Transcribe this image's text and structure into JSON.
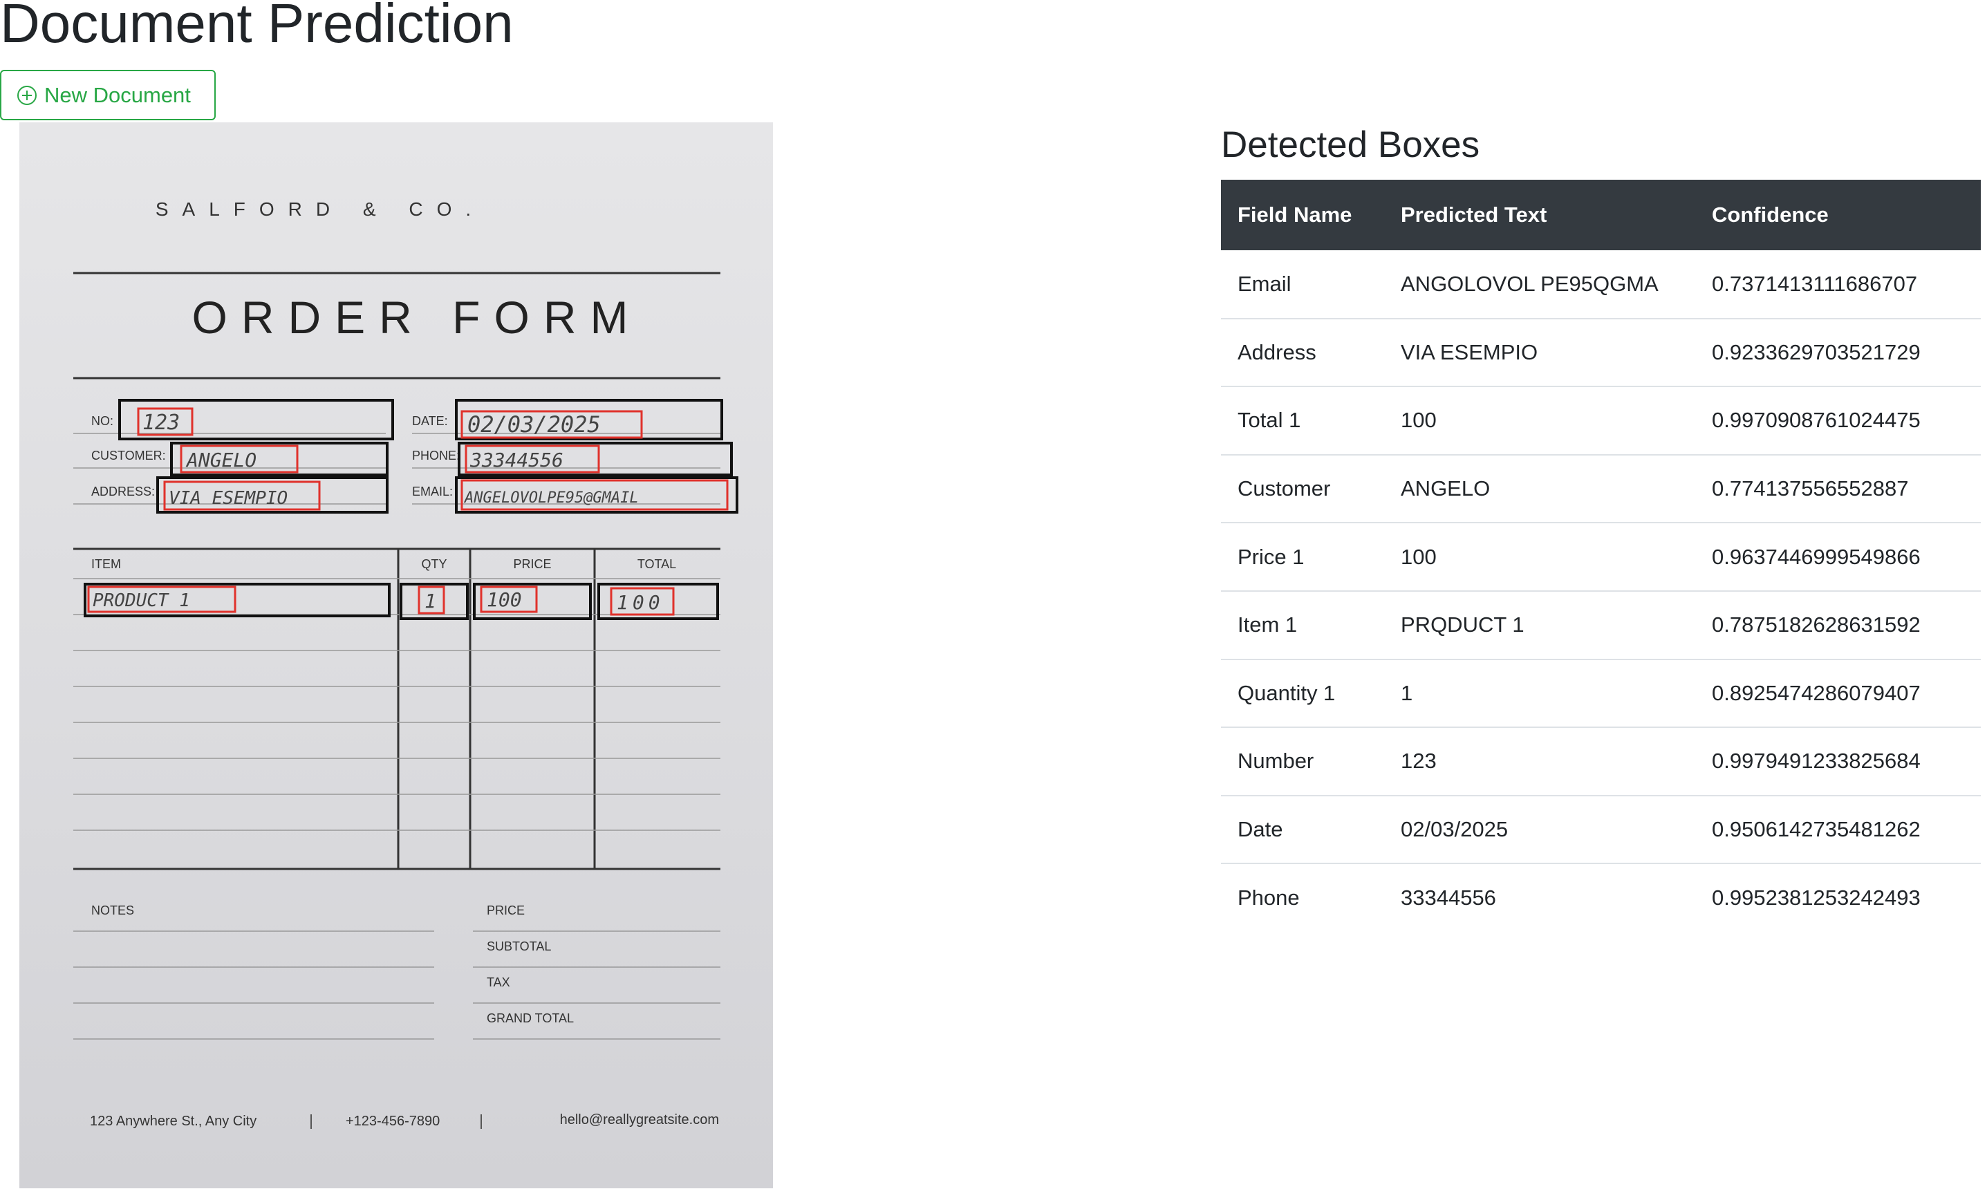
{
  "page": {
    "title": "Document Prediction",
    "new_button_label": "New Document",
    "new_button_icon": "plus-circle-icon"
  },
  "document": {
    "company": "SALFORD & CO.",
    "form_title": "ORDER FORM",
    "labels": {
      "no": "NO:",
      "customer": "CUSTOMER:",
      "address": "ADDRESS:",
      "date": "DATE:",
      "phone": "PHONE:",
      "email": "EMAIL:",
      "item": "ITEM",
      "qty": "QTY",
      "price": "PRICE",
      "total": "TOTAL",
      "notes": "NOTES",
      "price_summary": "PRICE",
      "subtotal": "SUBTOTAL",
      "tax": "TAX",
      "grand_total": "GRAND TOTAL"
    },
    "handwritten": {
      "no": "123",
      "customer": "ANGELO",
      "address": "VIA ESEMPIO",
      "date": "02/03/2025",
      "phone": "33344556",
      "email": "ANGELOVOLPE95@GMAIL",
      "item": "PRODUCT 1",
      "qty": "1",
      "price": "100",
      "total": "100"
    },
    "footer": {
      "address": "123 Anywhere St., Any City",
      "phone": "+123-456-7890",
      "email": "hello@reallygreatsite.com"
    }
  },
  "detected": {
    "title": "Detected Boxes",
    "headers": [
      "Field Name",
      "Predicted Text",
      "Confidence"
    ],
    "rows": [
      [
        "Email",
        "ANGOLOVOL PE95QGMA",
        "0.7371413111686707"
      ],
      [
        "Address",
        "VIA ESEMPIO",
        "0.9233629703521729"
      ],
      [
        "Total 1",
        "100",
        "0.9970908761024475"
      ],
      [
        "Customer",
        "ANGELO",
        "0.774137556552887"
      ],
      [
        "Price 1",
        "100",
        "0.9637446999549866"
      ],
      [
        "Item 1",
        "PRQDUCT 1",
        "0.7875182628631592"
      ],
      [
        "Quantity 1",
        "1",
        "0.8925474286079407"
      ],
      [
        "Number",
        "123",
        "0.9979491233825684"
      ],
      [
        "Date",
        "02/03/2025",
        "0.9506142735481262"
      ],
      [
        "Phone",
        "33344556",
        "0.9952381253242493"
      ]
    ]
  },
  "colors": {
    "accent_green": "#28a745",
    "detection_box_red": "#e0322c",
    "table_header_bg": "#343a40"
  }
}
